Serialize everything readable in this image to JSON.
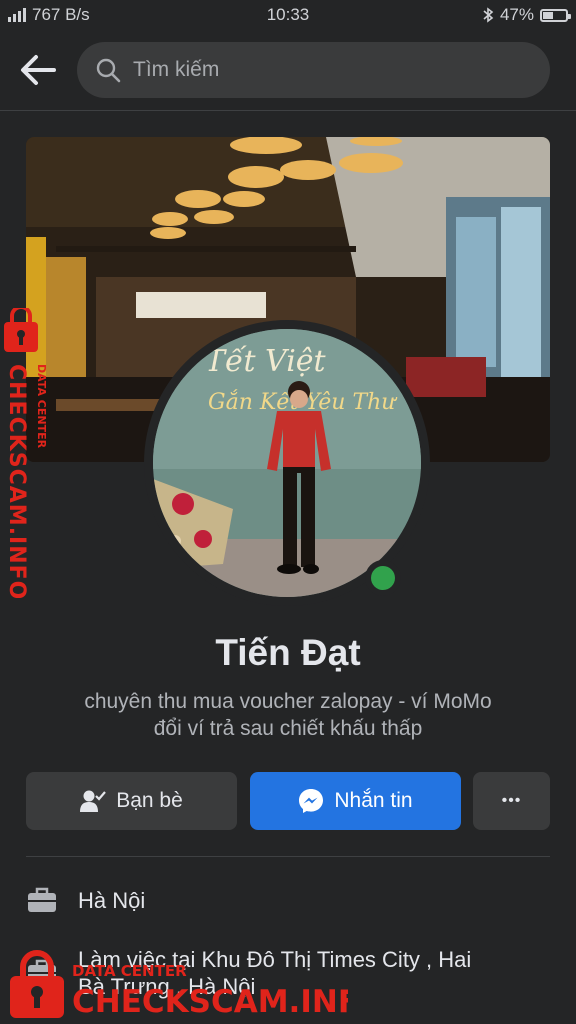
{
  "status_bar": {
    "network_speed": "767 B/s",
    "time": "10:33",
    "battery_text": "47%",
    "battery_level": 0.47
  },
  "search": {
    "placeholder": "Tìm kiếm"
  },
  "profile": {
    "name": "Tiến Đạt",
    "bio_line1": "chuyên thu mua voucher zalopay - ví MoMo",
    "bio_line2": "đổi ví trả sau chiết khấu thấp",
    "online": true,
    "avatar_text_line1": "Tết Việt",
    "avatar_text_line2": "Gắn Kết Yêu Thư"
  },
  "actions": {
    "friends_label": "Bạn bè",
    "message_label": "Nhắn tin",
    "more_label": "•••"
  },
  "info": {
    "location": "Hà Nội",
    "work_line1": "Làm việc tại Khu Đô Thị Times City , Hai",
    "work_line2": "Bà Trưng , Hà Nội"
  },
  "watermark": {
    "vertical_text": "CHECKSCAM.INFO",
    "vertical_sub": "DATA CENTER",
    "bottom_sub": "DATA CENTER",
    "bottom_text": "CHECKSCAM.INFO"
  },
  "colors": {
    "background": "#242526",
    "accent": "#2374e1",
    "online": "#31a24c",
    "watermark": "#e0241b"
  }
}
